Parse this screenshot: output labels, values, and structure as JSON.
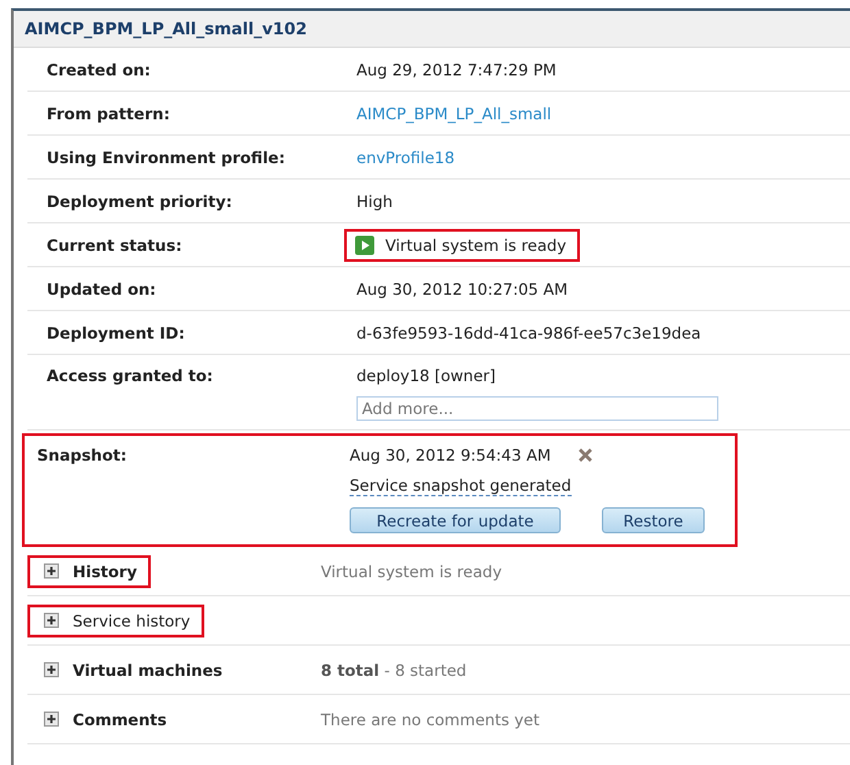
{
  "window": {
    "title": "AIMCP_BPM_LP_All_small_v102"
  },
  "properties": [
    {
      "kind": "text",
      "label": "Created on:",
      "value": "Aug 29, 2012 7:47:29 PM"
    },
    {
      "kind": "link",
      "label": "From pattern:",
      "value": "AIMCP_BPM_LP_All_small"
    },
    {
      "kind": "link",
      "label": "Using Environment profile:",
      "value": "envProfile18"
    },
    {
      "kind": "text",
      "label": "Deployment priority:",
      "value": "High"
    },
    {
      "kind": "status",
      "label": "Current status:",
      "value": "Virtual system is ready",
      "highlighted": true
    },
    {
      "kind": "text",
      "label": "Updated on:",
      "value": "Aug 30, 2012 10:27:05 AM"
    },
    {
      "kind": "text",
      "label": "Deployment ID:",
      "value": "d-63fe9593-16dd-41ca-986f-ee57c3e19dea"
    },
    {
      "kind": "access",
      "label": "Access granted to:",
      "value": "deploy18 [owner]",
      "placeholder": "Add more..."
    },
    {
      "kind": "snapshot",
      "label": "Snapshot:",
      "value": "Aug 30, 2012 9:54:43 AM",
      "note": "Service snapshot generated",
      "buttons": [
        "Recreate for update",
        "Restore"
      ],
      "highlighted": true
    }
  ],
  "sections": [
    {
      "label": "History",
      "bold": true,
      "expanded": false,
      "summary": "Virtual system is ready",
      "highlighted": true
    },
    {
      "label": "Service history",
      "bold": false,
      "expanded": false,
      "highlighted": true
    },
    {
      "label": "Virtual machines",
      "bold": true,
      "expanded": false,
      "summary": "**8 total** - 8 started"
    },
    {
      "label": "Comments",
      "bold": true,
      "expanded": false,
      "summary": "There are no comments yet"
    }
  ]
}
